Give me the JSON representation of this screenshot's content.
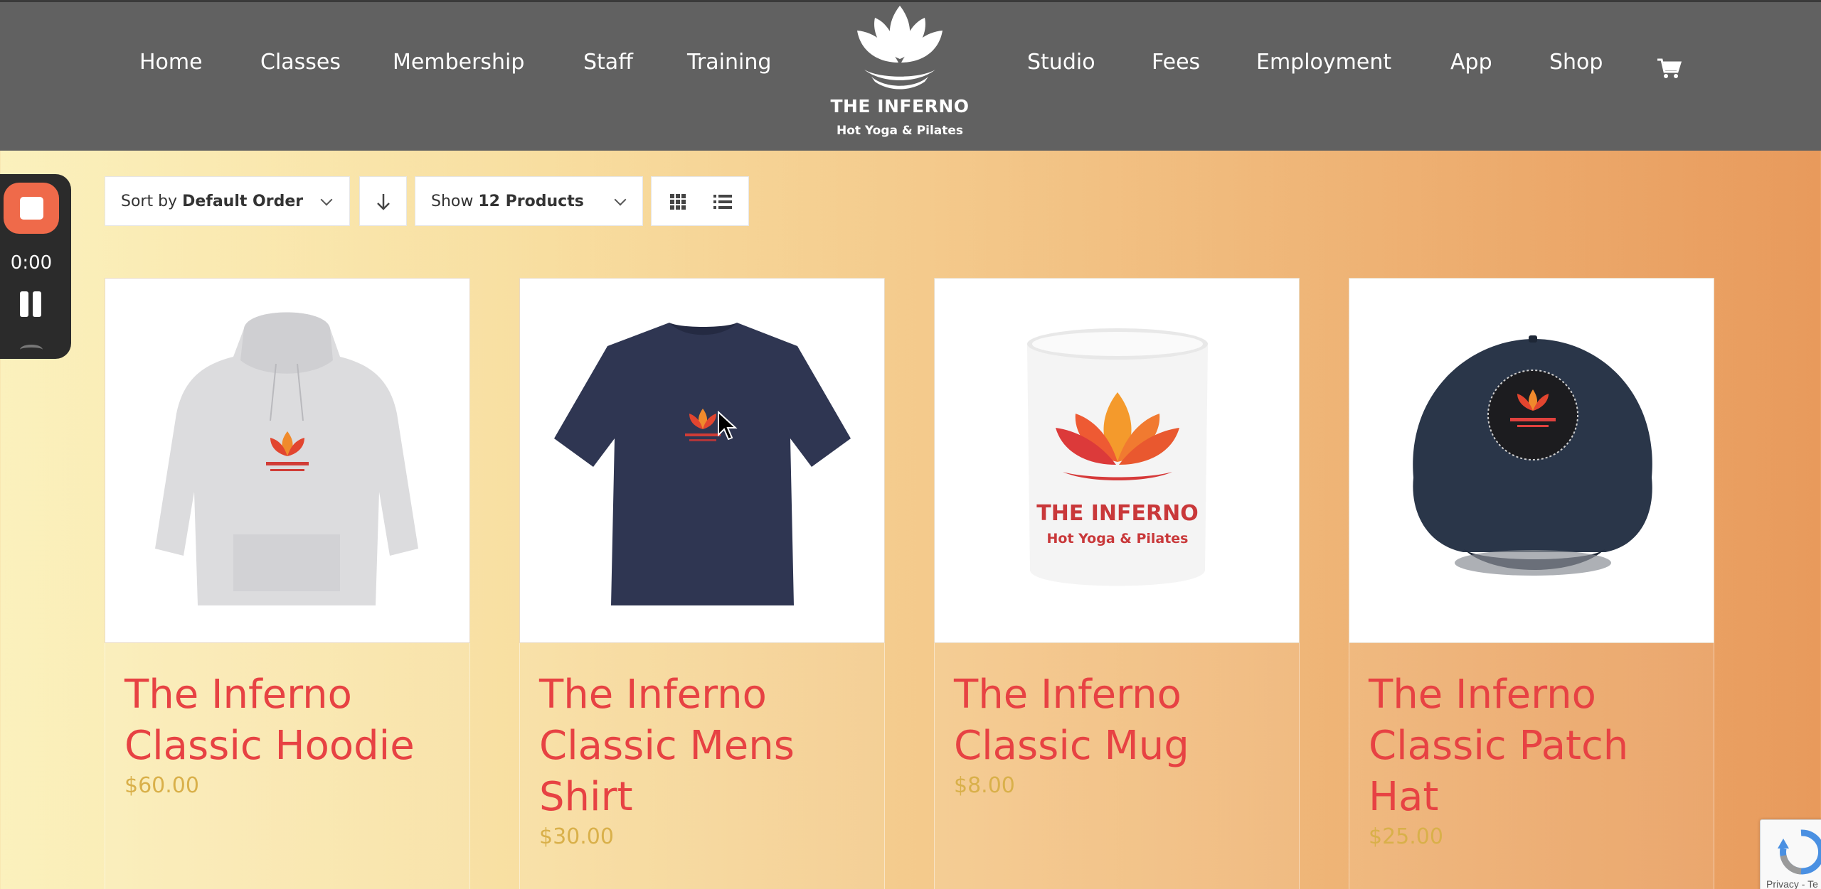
{
  "nav": {
    "left": [
      "Home",
      "Classes",
      "Membership",
      "Staff",
      "Training"
    ],
    "right": [
      "Studio",
      "Fees",
      "Employment",
      "App",
      "Shop"
    ],
    "cart_icon": "shopping-cart-icon"
  },
  "logo": {
    "title": "THE INFERNO",
    "subtitle": "Hot Yoga & Pilates"
  },
  "recorder": {
    "time": "0:00"
  },
  "toolbar": {
    "sort_prefix": "Sort by",
    "sort_value": "Default Order",
    "show_prefix": "Show",
    "show_value": "12 Products",
    "direction_icon": "arrow-down-icon",
    "grid_icon": "grid-view-icon",
    "list_icon": "list-view-icon"
  },
  "products": [
    {
      "title": "The Inferno Classic Hoodie",
      "price": "$60.00",
      "image": "hoodie"
    },
    {
      "title": "The Inferno Classic Mens Shirt",
      "price": "$30.00",
      "image": "tshirt"
    },
    {
      "title": "The Inferno Classic Mug",
      "price": "$8.00",
      "image": "mug"
    },
    {
      "title": "The Inferno Classic Patch Hat",
      "price": "$25.00",
      "image": "cap"
    }
  ],
  "mug_print": {
    "title": "THE INFERNO",
    "subtitle": "Hot Yoga & Pilates"
  },
  "recaptcha": {
    "text": "Privacy - Te"
  },
  "colors": {
    "header_bg": "#616161",
    "title_red": "#e74243",
    "price_gold": "#d9b04a",
    "recorder_stop": "#ef6a4a"
  }
}
